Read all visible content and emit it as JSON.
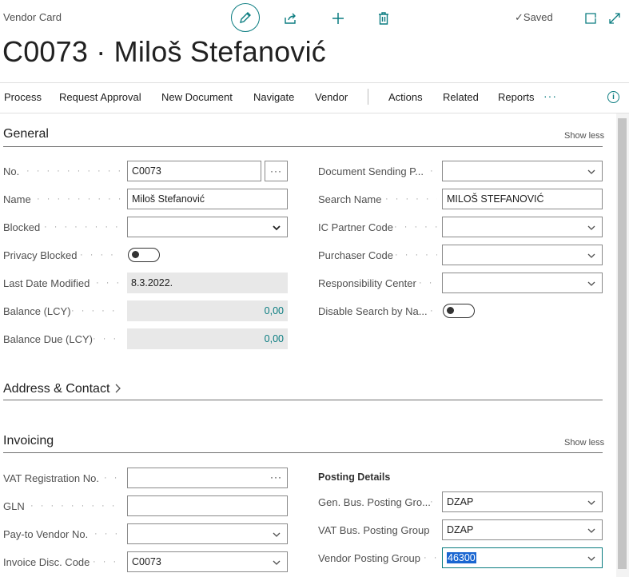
{
  "header": {
    "caption": "Vendor Card",
    "title": "C0073 · Miloš Stefanović",
    "status": "Saved",
    "icons": [
      "edit-icon",
      "share-icon",
      "add-icon",
      "delete-icon",
      "open-new-window-icon",
      "expand-icon"
    ]
  },
  "actions": {
    "items": [
      "Process",
      "Request Approval",
      "New Document",
      "Navigate",
      "Vendor",
      "Actions",
      "Related",
      "Reports"
    ],
    "more": "···"
  },
  "general": {
    "title": "General",
    "toggle": "Show less",
    "fields": {
      "no": {
        "label": "No.",
        "value": "C0073"
      },
      "name": {
        "label": "Name",
        "value": "Miloš Stefanović"
      },
      "blocked": {
        "label": "Blocked",
        "value": ""
      },
      "privacy_blocked": {
        "label": "Privacy Blocked",
        "value": false
      },
      "last_date_modified": {
        "label": "Last Date Modified",
        "value": "8.3.2022."
      },
      "balance_lcy": {
        "label": "Balance (LCY)",
        "value": "0,00"
      },
      "balance_due_lcy": {
        "label": "Balance Due (LCY)",
        "value": "0,00"
      },
      "document_sending": {
        "label": "Document Sending P...",
        "value": ""
      },
      "search_name": {
        "label": "Search Name",
        "value": "MILOŠ STEFANOVIĆ"
      },
      "ic_partner_code": {
        "label": "IC Partner Code",
        "value": ""
      },
      "purchaser_code": {
        "label": "Purchaser Code",
        "value": ""
      },
      "responsibility_center": {
        "label": "Responsibility Center",
        "value": ""
      },
      "disable_search": {
        "label": "Disable Search by Na...",
        "value": false
      }
    }
  },
  "address": {
    "title": "Address & Contact"
  },
  "invoicing": {
    "title": "Invoicing",
    "toggle": "Show less",
    "posting_details": "Posting Details",
    "fields": {
      "vat_reg_no": {
        "label": "VAT Registration No.",
        "value": ""
      },
      "gln": {
        "label": "GLN",
        "value": ""
      },
      "pay_to_vendor": {
        "label": "Pay-to Vendor No.",
        "value": ""
      },
      "invoice_disc_code": {
        "label": "Invoice Disc. Code",
        "value": "C0073"
      },
      "gen_bus_posting": {
        "label": "Gen. Bus. Posting Gro...",
        "value": "DZAP"
      },
      "vat_bus_posting": {
        "label": "VAT Bus. Posting Group",
        "value": "DZAP"
      },
      "vendor_posting": {
        "label": "Vendor Posting Group",
        "value": "46300"
      }
    }
  },
  "colors": {
    "accent": "#0a7c80",
    "selection": "#1a66d1"
  }
}
